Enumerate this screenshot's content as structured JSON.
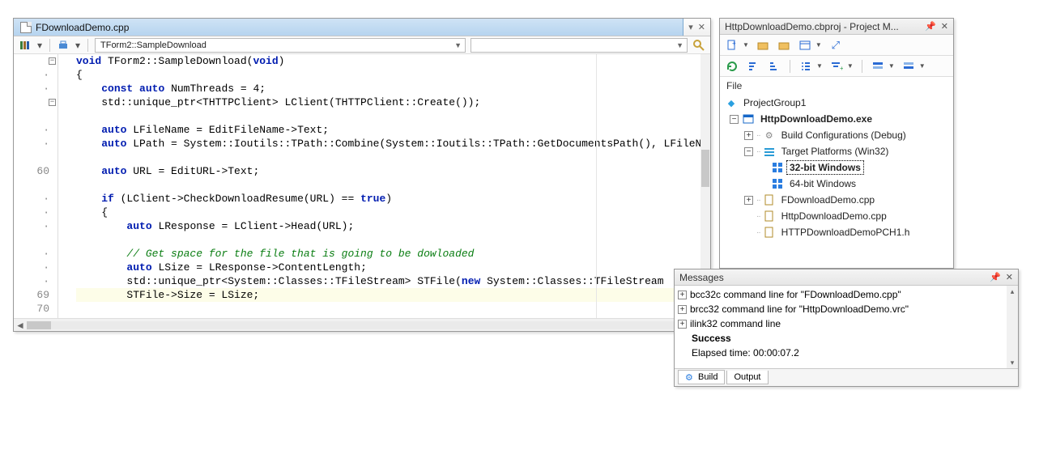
{
  "editor": {
    "tab_filename": "FDownloadDemo.cpp",
    "nav_scope": "TForm2::SampleDownload",
    "nav_member": "",
    "gutter": {
      "line60": "60",
      "line69": "69",
      "line70": "70"
    },
    "code": {
      "l1": {
        "kw1": "void",
        "rest1": " TForm2::SampleDownload(",
        "kw2": "void",
        "rest2": ")"
      },
      "l2": "{",
      "l3": {
        "p": "    ",
        "kw1": "const",
        "sp": " ",
        "kw2": "auto",
        "rest": " NumThreads = 4;"
      },
      "l4": "    std::unique_ptr<THTTPClient> LClient(THTTPClient::Create());",
      "l5": "",
      "l6": {
        "p": "    ",
        "kw": "auto",
        "rest": " LFileName = EditFileName->Text;"
      },
      "l7": {
        "p": "    ",
        "kw": "auto",
        "rest": " LPath = System::Ioutils::TPath::Combine(System::Ioutils::TPath::GetDocumentsPath(), LFileN"
      },
      "l8": "",
      "l9": {
        "p": "    ",
        "kw": "auto",
        "rest": " URL = EditURL->Text;"
      },
      "l10": "",
      "l11": {
        "p": "    ",
        "kw1": "if",
        "mid": " (LClient->CheckDownloadResume(URL) == ",
        "kw2": "true",
        "end": ")"
      },
      "l12": "    {",
      "l13": {
        "p": "        ",
        "kw": "auto",
        "rest": " LResponse = LClient->Head(URL);"
      },
      "l14": "",
      "l15": "        // Get space for the file that is going to be dowloaded",
      "l16": {
        "p": "        ",
        "kw": "auto",
        "rest": " LSize = LResponse->ContentLength;"
      },
      "l17": {
        "p": "        std::unique_ptr<System::Classes::TFileStream> STFile(",
        "kw": "new",
        "rest": " System::Classes::TFileStream"
      },
      "l18": "        STFile->Size = LSize;",
      "l19": ""
    }
  },
  "project": {
    "title": "HttpDownloadDemo.cbproj - Project M...",
    "file_label": "File",
    "tree": {
      "root": "ProjectGroup1",
      "exe": "HttpDownloadDemo.exe",
      "build": "Build Configurations (Debug)",
      "targets": "Target Platforms (Win32)",
      "win32": "32-bit Windows",
      "win64": "64-bit Windows",
      "f1": "FDownloadDemo.cpp",
      "f2": "HttpDownloadDemo.cpp",
      "f3": "HTTPDownloadDemoPCH1.h"
    }
  },
  "messages": {
    "title": "Messages",
    "rows": {
      "r1": "bcc32c command line for \"FDownloadDemo.cpp\"",
      "r2": "brcc32 command line for \"HttpDownloadDemo.vrc\"",
      "r3": "ilink32 command line",
      "r4": "Success",
      "r5": "Elapsed time: 00:00:07.2"
    },
    "tabs": {
      "build": "Build",
      "output": "Output"
    }
  }
}
